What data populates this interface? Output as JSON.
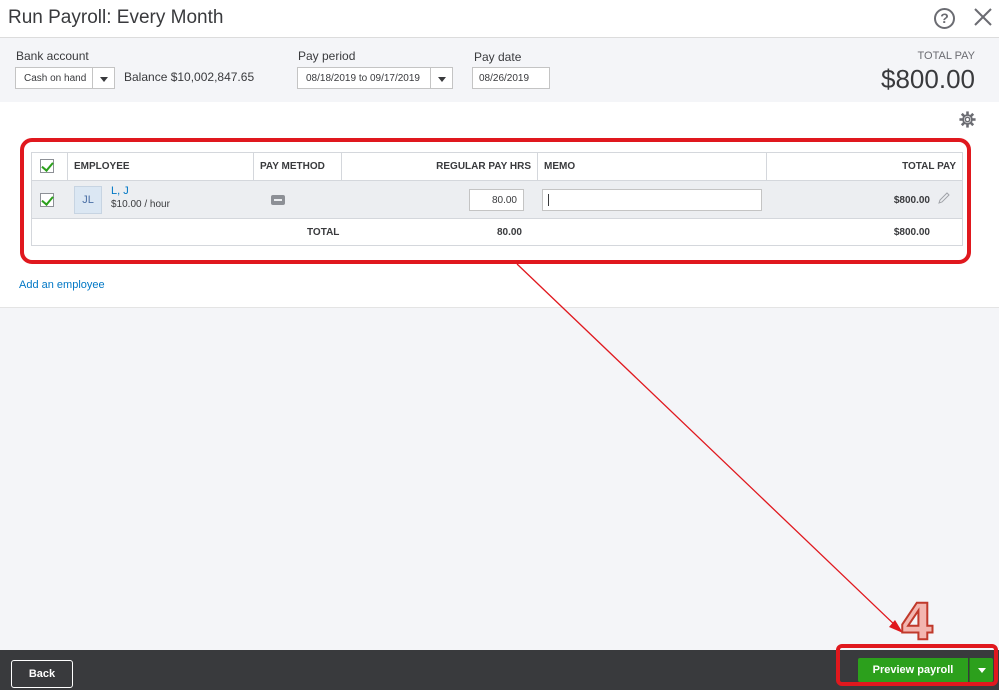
{
  "window": {
    "title": "Run Payroll: Every Month"
  },
  "header": {
    "bank_account_label": "Bank account",
    "bank_account_value": "Cash on hand",
    "balance": "Balance $10,002,847.65",
    "pay_period_label": "Pay period",
    "pay_period_value": "08/18/2019 to 09/17/2019",
    "pay_date_label": "Pay date",
    "pay_date_value": "08/26/2019",
    "total_pay_label": "TOTAL PAY",
    "total_pay_value": "$800.00"
  },
  "table": {
    "headers": {
      "employee": "EMPLOYEE",
      "pay_method": "PAY METHOD",
      "regular_pay_hrs": "REGULAR PAY HRS",
      "memo": "MEMO",
      "total_pay": "TOTAL PAY"
    },
    "rows": [
      {
        "initials": "JL",
        "name": "L, J",
        "rate": "$10.00 / hour",
        "regular_pay_hrs": "80.00",
        "memo": "",
        "total_pay": "$800.00",
        "checked": true
      }
    ],
    "footer": {
      "label": "TOTAL",
      "hrs_total": "80.00",
      "pay_total": "$800.00"
    }
  },
  "links": {
    "add_employee": "Add an employee"
  },
  "annotation": {
    "step_number": "4",
    "color": "#e0181e"
  },
  "footer": {
    "back_label": "Back",
    "preview_label": "Preview payroll"
  },
  "colors": {
    "accent_green": "#2ca01c",
    "link_blue": "#0077c5",
    "footer_bg": "#393a3d"
  }
}
